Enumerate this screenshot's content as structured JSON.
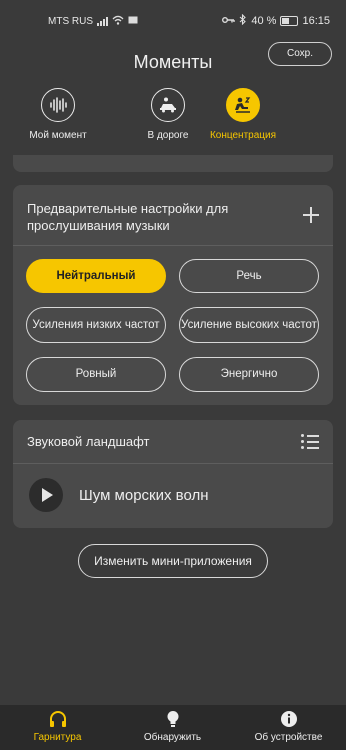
{
  "status": {
    "carrier": "MTS RUS",
    "battery": "40 %",
    "time": "16:15"
  },
  "header": {
    "title": "Моменты",
    "save_label": "Сохр."
  },
  "modes": [
    {
      "label": "Мой момент",
      "icon": "soundwave-icon",
      "active": false
    },
    {
      "label": "В дороге",
      "icon": "car-icon",
      "active": false
    },
    {
      "label": "Концентрация",
      "icon": "focus-person-icon",
      "active": true
    }
  ],
  "presets": {
    "title": "Предварительные настройки для прослушивания музыки",
    "options": [
      "Нейтральный",
      "Речь",
      "Усиления низких частот",
      "Усиление высоких частот",
      "Ровный",
      "Энергично"
    ],
    "selected": "Нейтральный"
  },
  "soundscape": {
    "title": "Звуковой ландшафт",
    "track": "Шум морских волн"
  },
  "edit_label": "Изменить мини-приложения",
  "tabs": [
    {
      "label": "Гарнитура",
      "icon": "headphones-icon",
      "active": true
    },
    {
      "label": "Обнаружить",
      "icon": "lightbulb-icon",
      "active": false
    },
    {
      "label": "Об устройстве",
      "icon": "info-icon",
      "active": false
    }
  ],
  "colors": {
    "accent": "#f6c600",
    "background": "#3a3a3a",
    "card": "#4a4a4a",
    "tabbar": "#2a2a2a"
  }
}
